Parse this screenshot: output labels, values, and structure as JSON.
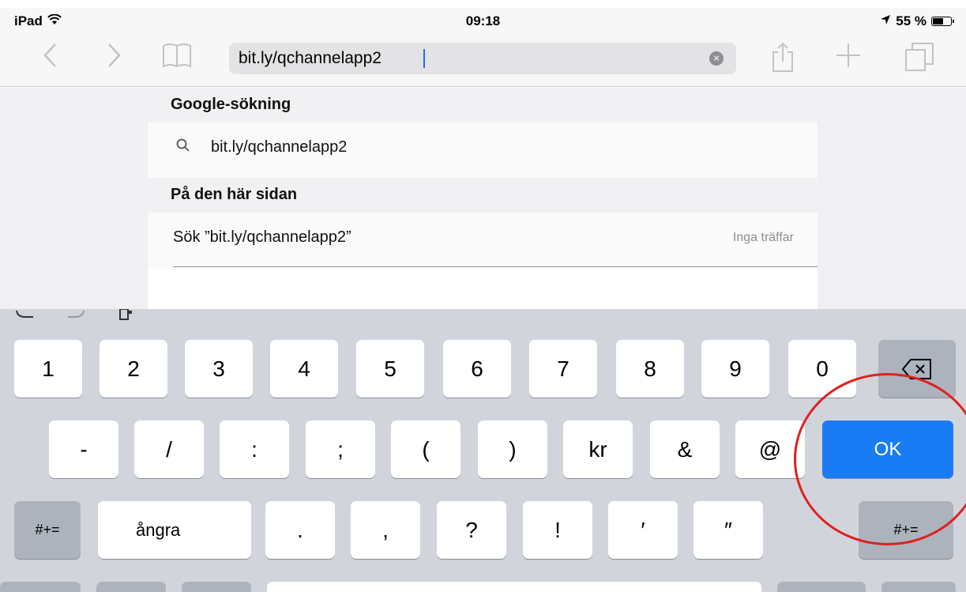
{
  "status_bar": {
    "device": "iPad",
    "time": "09:18",
    "battery_text": "55 %"
  },
  "toolbar": {
    "url_value": "bit.ly/qchannelapp2",
    "icons": [
      "back-icon",
      "forward-icon",
      "bookmarks-icon",
      "clear-icon",
      "share-icon",
      "add-icon",
      "tabs-icon"
    ]
  },
  "suggestions": {
    "google_header": "Google-sökning",
    "google_query": "bit.ly/qchannelapp2",
    "page_header": "På den här sidan",
    "find_label": "Sök ”bit.ly/qchannelapp2”",
    "find_hint": "Inga träffar"
  },
  "keyboard": {
    "row1": [
      "1",
      "2",
      "3",
      "4",
      "5",
      "6",
      "7",
      "8",
      "9",
      "0"
    ],
    "row2": [
      "-",
      "/",
      ":",
      ";",
      "(",
      ")",
      "kr",
      "&",
      "@"
    ],
    "ok_label": "OK",
    "row3_left": "#+=",
    "undo_label": "ångra",
    "row3": [
      ".",
      ",",
      "?",
      "!",
      "′",
      "″"
    ],
    "row3_right": "#+=",
    "colors": {
      "ok": "#1a7cf5",
      "highlight_ring": "#e0201f"
    }
  }
}
